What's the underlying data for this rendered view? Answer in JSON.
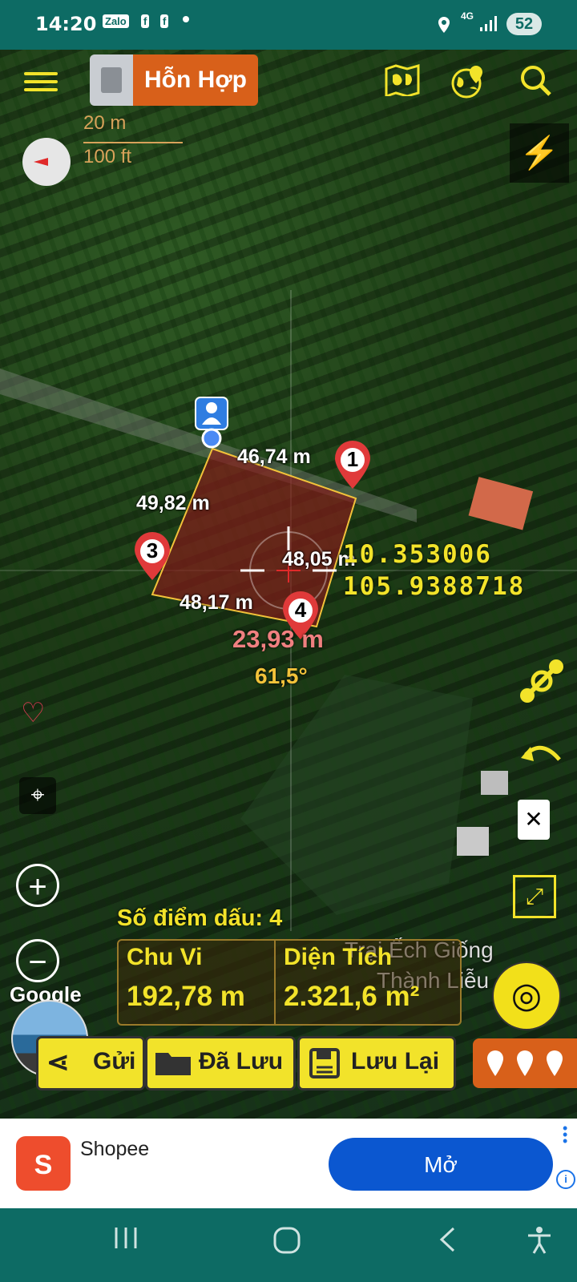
{
  "status_bar": {
    "time": "14:20",
    "zalo": "Zalo",
    "fb1": "f",
    "fb2": "f",
    "network": "4G",
    "battery": "52"
  },
  "toolbar": {
    "layer_label": "Hỗn Hợp"
  },
  "scale": {
    "metric": "20 m",
    "imperial": "100 ft"
  },
  "measurements": {
    "side_1": "46,74 m",
    "side_2": "49,82 m",
    "side_3": "48,17 m",
    "side_4": "48,05 m",
    "cursor_distance": "23,93 m",
    "cursor_angle": "61,5°",
    "latitude": "10.353006",
    "longitude": "105.9388718"
  },
  "pins": [
    {
      "num": "1"
    },
    {
      "num": "3"
    },
    {
      "num": "4"
    }
  ],
  "summary": {
    "marks_count": "Số điểm dấu: 4",
    "perimeter_label": "Chu Vi",
    "perimeter_value": "192,78 m",
    "area_label": "Diện Tích",
    "area_value": "2.321,6 m²"
  },
  "poi": {
    "line1": "Trại Ếch Giống",
    "line2": "Thành Liễu"
  },
  "google_label": "Google",
  "actions": {
    "send": "Gửi",
    "saved": "Đã Lưu",
    "save": "Lưu Lại"
  },
  "ad": {
    "name": "Shopee",
    "open": "Mở",
    "logo": "S"
  },
  "colors": {
    "accent_yellow": "#f2e32a",
    "layer_orange": "#d8601a",
    "polygon_fill": "#8b1a1a",
    "ad_button": "#0b57d0"
  }
}
